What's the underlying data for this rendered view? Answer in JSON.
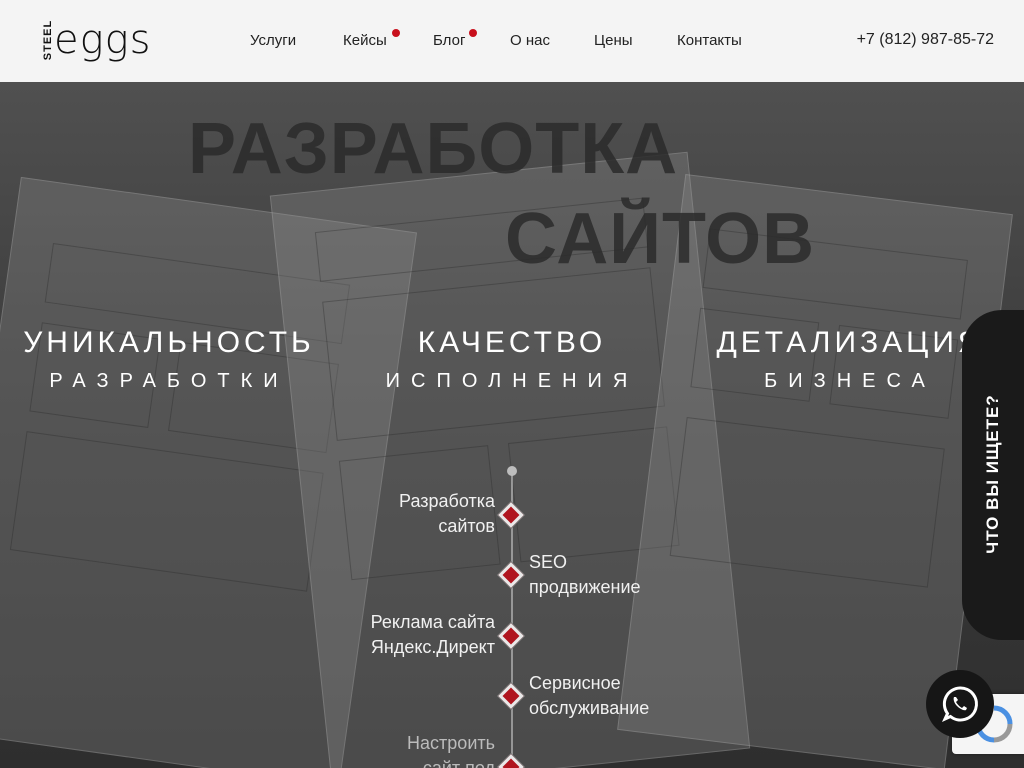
{
  "logo": {
    "small": "STEEL",
    "main": "eggs"
  },
  "nav": [
    {
      "label": "Услуги",
      "dot": false
    },
    {
      "label": "Кейсы",
      "dot": true
    },
    {
      "label": "Блог",
      "dot": true
    },
    {
      "label": "О нас",
      "dot": false
    },
    {
      "label": "Цены",
      "dot": false
    },
    {
      "label": "Контакты",
      "dot": false
    }
  ],
  "phone": "+7 (812) 987-85-72",
  "hero": {
    "title_line1": "РАЗРАБОТКА",
    "title_line2": "САЙТОВ",
    "features": [
      {
        "heading": "УНИКАЛЬНОСТЬ",
        "sub": "РАЗРАБОТКИ"
      },
      {
        "heading": "КАЧЕСТВО",
        "sub": "ИСПОЛНЕНИЯ"
      },
      {
        "heading": "ДЕТАЛИЗАЦИЯ",
        "sub": "БИЗНЕСА"
      }
    ],
    "timeline": [
      {
        "line1": "Разработка",
        "line2": "сайтов"
      },
      {
        "line1": "SEO",
        "line2": "продвижение"
      },
      {
        "line1": "Реклама сайта",
        "line2": "Яндекс.Директ"
      },
      {
        "line1": "Сервисное",
        "line2": "обслуживание"
      },
      {
        "line1": "Настроить",
        "line2": "сайт под"
      }
    ]
  },
  "side_tab": "ЧТО ВЫ ИЩЕТЕ?",
  "colors": {
    "accent": "#b0151f",
    "header_bg": "#f4f4f4",
    "hero_bg": "#3b3b3b"
  },
  "icons": {
    "whatsapp": "whatsapp-icon",
    "recaptcha": "recaptcha-icon"
  }
}
